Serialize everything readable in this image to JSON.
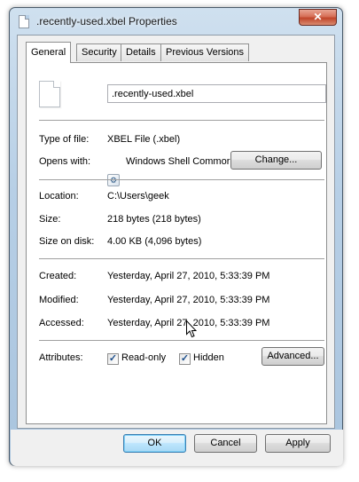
{
  "window": {
    "title": ".recently-used.xbel Properties",
    "close_label": "✕"
  },
  "tabs": [
    {
      "label": "General"
    },
    {
      "label": "Security"
    },
    {
      "label": "Details"
    },
    {
      "label": "Previous Versions"
    }
  ],
  "general": {
    "file_name": ".recently-used.xbel",
    "type_label": "Type of file:",
    "type_value": "XBEL File (.xbel)",
    "opens_label": "Opens with:",
    "opens_value": "Windows Shell Commor",
    "change_label": "Change...",
    "location_label": "Location:",
    "location_value": "C:\\Users\\geek",
    "size_label": "Size:",
    "size_value": "218 bytes (218 bytes)",
    "size_disk_label": "Size on disk:",
    "size_disk_value": "4.00 KB (4,096 bytes)",
    "created_label": "Created:",
    "created_value": "Yesterday, April 27, 2010, 5:33:39 PM",
    "modified_label": "Modified:",
    "modified_value": "Yesterday, April 27, 2010, 5:33:39 PM",
    "accessed_label": "Accessed:",
    "accessed_value": "Yesterday, April 27, 2010, 5:33:39 PM",
    "attributes_label": "Attributes:",
    "readonly_label": "Read-only",
    "readonly_checked": true,
    "hidden_label": "Hidden",
    "hidden_checked": true,
    "advanced_label": "Advanced..."
  },
  "buttons": {
    "ok": "OK",
    "cancel": "Cancel",
    "apply": "Apply"
  },
  "icons": {
    "file": "document-icon",
    "app": "shell-app-icon",
    "check": "✓"
  }
}
